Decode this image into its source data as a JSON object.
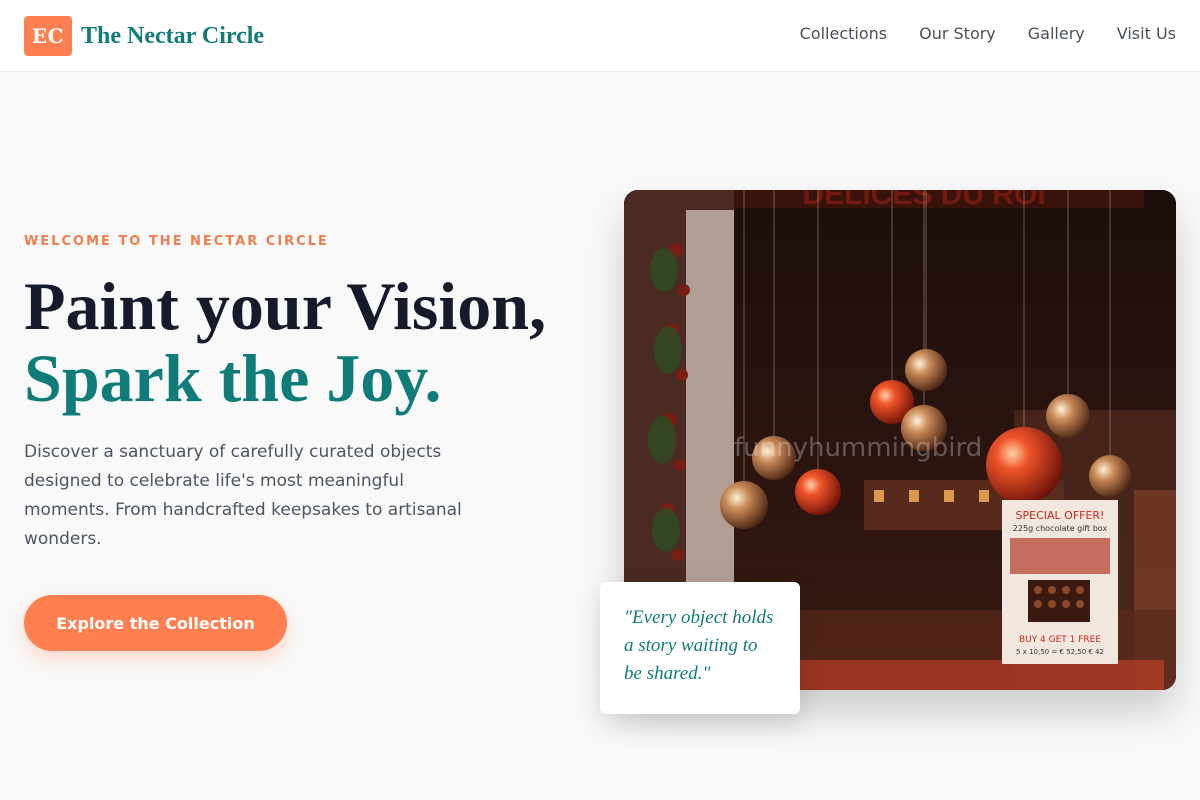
{
  "header": {
    "logo_text": "EC",
    "brand_name": "The Nectar Circle",
    "nav": [
      {
        "label": "Collections"
      },
      {
        "label": "Our Story"
      },
      {
        "label": "Gallery"
      },
      {
        "label": "Visit Us"
      }
    ]
  },
  "hero": {
    "eyebrow": "WELCOME TO THE NECTAR CIRCLE",
    "headline_line1": "Paint your Vision,",
    "headline_line2": "Spark the Joy.",
    "description": "Discover a sanctuary of carefully curated objects designed to celebrate life's most meaningful moments. From handcrafted keepsakes to artisanal wonders.",
    "cta_label": "Explore the Collection"
  },
  "image": {
    "sign_text": "DELICES DU ROI",
    "poster_title": "SPECIAL OFFER!",
    "poster_subtitle": "225g chocolate gift box",
    "poster_deal": "BUY 4 GET 1 FREE",
    "poster_price": "5 x 10,50 = € 52,50   € 42",
    "watermark": "funnyhummingbird"
  },
  "quote": {
    "text": "\"Every object holds a story waiting to be shared.\""
  },
  "colors": {
    "accent_orange": "#ff7f50",
    "accent_teal": "#0f7c79",
    "headline_dark": "#161a2b"
  }
}
